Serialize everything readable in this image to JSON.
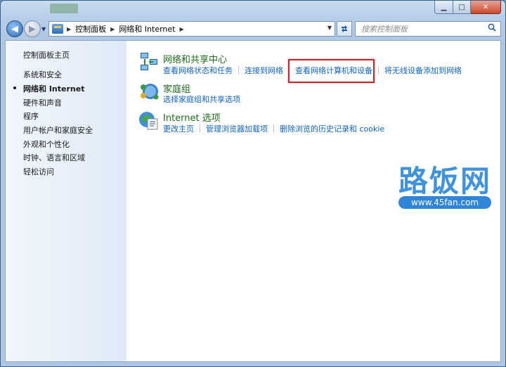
{
  "window": {
    "caption_minimize": "▁",
    "caption_maximize": "□",
    "caption_close": "✕"
  },
  "nav": {
    "back_glyph": "◀",
    "forward_glyph": "▶",
    "breadcrumb": [
      "控制面板",
      "网络和 Internet"
    ],
    "search_placeholder": "搜索控制面板"
  },
  "sidebar": {
    "items": [
      {
        "label": "控制面板主页"
      },
      {
        "label": "系统和安全"
      },
      {
        "label": "网络和 Internet",
        "active": true
      },
      {
        "label": "硬件和声音"
      },
      {
        "label": "程序"
      },
      {
        "label": "用户帐户和家庭安全"
      },
      {
        "label": "外观和个性化"
      },
      {
        "label": "时钟、语言和区域"
      },
      {
        "label": "轻松访问"
      }
    ]
  },
  "main": {
    "categories": [
      {
        "title": "网络和共享中心",
        "icon": "network-sharing-icon",
        "links": [
          "查看网络状态和任务",
          "连接到网络",
          "查看网络计算机和设备",
          "将无线设备添加到网络"
        ]
      },
      {
        "title": "家庭组",
        "icon": "homegroup-icon",
        "links": [
          "选择家庭组和共享选项"
        ]
      },
      {
        "title": "Internet 选项",
        "icon": "internet-options-icon",
        "links": [
          "更改主页",
          "管理浏览器加载项",
          "删除浏览的历史记录和 cookie"
        ]
      }
    ],
    "highlight_color": "#d0222b"
  },
  "watermark": {
    "text": "路饭网",
    "url": "www.45fan.com"
  },
  "colors": {
    "link": "#0d64c2",
    "category_title": "#1e6b1e"
  }
}
